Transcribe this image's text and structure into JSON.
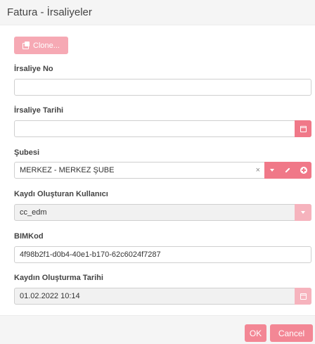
{
  "header": {
    "title": "Fatura - İrsaliyeler"
  },
  "toolbar": {
    "clone_label": "Clone..."
  },
  "fields": {
    "irsaliye_no": {
      "label": "İrsaliye No",
      "value": ""
    },
    "irsaliye_tarihi": {
      "label": "İrsaliye Tarihi",
      "value": ""
    },
    "subesi": {
      "label": "Şubesi",
      "value": "MERKEZ - MERKEZ ŞUBE",
      "clear": "×"
    },
    "kaydi_olusturan": {
      "label": "Kaydı Oluşturan Kullanıcı",
      "value": "cc_edm"
    },
    "bimkod": {
      "label": "BIMKod",
      "value": "4f98b2f1-d0b4-40e1-b170-62c6024f7287"
    },
    "kaydin_olusturma_tarihi": {
      "label": "Kaydın Oluşturma Tarihi",
      "value": "01.02.2022 10:14"
    }
  },
  "footer": {
    "ok_label": "OK",
    "cancel_label": "Cancel"
  },
  "colors": {
    "accent": "#f07888",
    "accent_faded": "#f6b3bd",
    "button": "#f38795"
  },
  "icons": [
    "clone-icon",
    "calendar-icon",
    "chevron-down-icon",
    "pencil-icon",
    "plus-circle-icon",
    "close-icon"
  ]
}
